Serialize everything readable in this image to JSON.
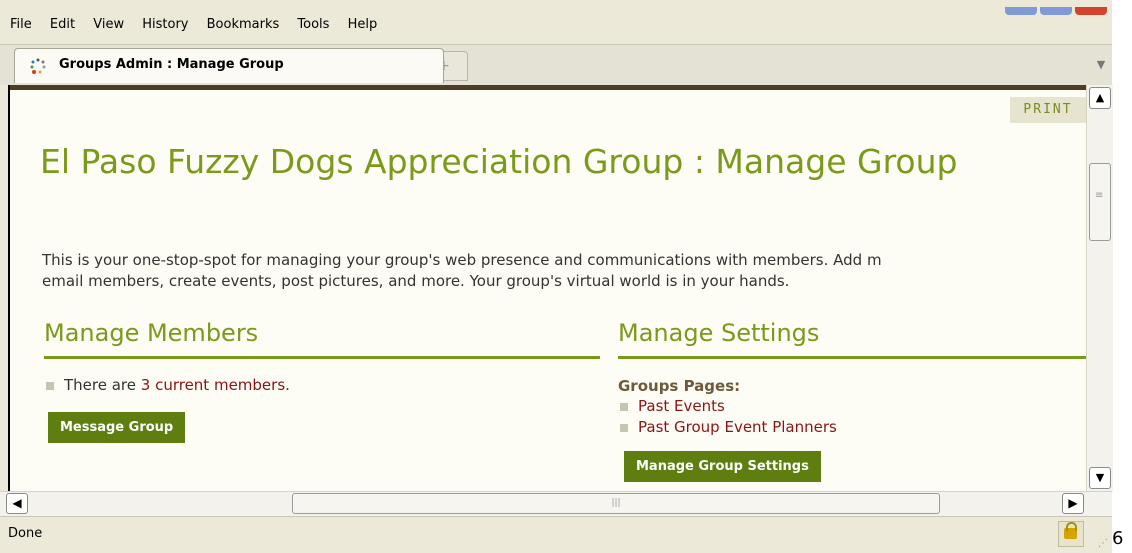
{
  "menu": [
    "File",
    "Edit",
    "View",
    "History",
    "Bookmarks",
    "Tools",
    "Help"
  ],
  "tab": {
    "title": "Groups Admin : Manage Group",
    "new_tab_symbol": "+"
  },
  "page": {
    "print_label": "PRINT",
    "heading": "El Paso Fuzzy Dogs Appreciation Group : Manage Group",
    "intro_line1": "This is your one-stop-spot for managing your group's web presence and communications with members. Add m",
    "intro_line2": "email members, create events, post pictures, and more. Your group's virtual world is in your hands.",
    "members": {
      "title": "Manage Members",
      "count_prefix": "There are ",
      "count_link": "3 current members",
      "count_suffix": ".",
      "button": "Message Group"
    },
    "settings": {
      "title": "Manage Settings",
      "subhead": "Groups Pages:",
      "links": [
        "Past Events",
        "Past Group Event Planners"
      ],
      "button": "Manage Group Settings"
    }
  },
  "status": {
    "text": "Done"
  },
  "edge_glyph": "6",
  "colors": {
    "accent": "#7a9a1a",
    "button": "#5e7f0f",
    "link": "#8a1515"
  }
}
